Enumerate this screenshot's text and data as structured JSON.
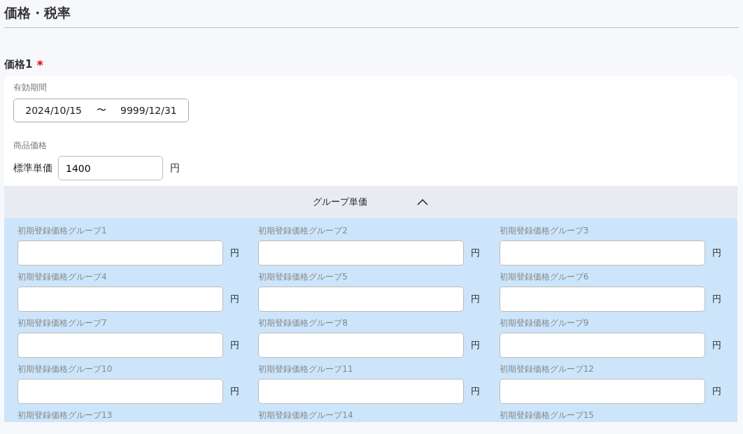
{
  "section_title": "価格・税率",
  "price": {
    "label": "価格1",
    "required_mark": "*",
    "period": {
      "label": "有効期間",
      "start": "2024/10/15",
      "separator": "〜",
      "end": "9999/12/31"
    },
    "product_price": {
      "label": "商品価格",
      "field_label": "標準単価",
      "value": "1400",
      "unit": "円"
    }
  },
  "group_panel": {
    "title": "グループ単価",
    "expanded": true,
    "groups": [
      {
        "label": "初期登録価格グループ1",
        "kind": "field",
        "unit": "円"
      },
      {
        "label": "初期登録価格グループ2",
        "kind": "field",
        "unit": "円"
      },
      {
        "label": "初期登録価格グループ3",
        "kind": "field",
        "unit": "円"
      },
      {
        "label": "初期登録価格グループ4",
        "kind": "field",
        "unit": "円"
      },
      {
        "label": "初期登録価格グループ5",
        "kind": "field",
        "unit": "円"
      },
      {
        "label": "初期登録価格グループ6",
        "kind": "field",
        "unit": "円"
      },
      {
        "label": "初期登録価格グループ7",
        "kind": "field",
        "unit": "円"
      },
      {
        "label": "初期登録価格グループ8",
        "kind": "field",
        "unit": "円"
      },
      {
        "label": "初期登録価格グループ9",
        "kind": "field",
        "unit": "円"
      },
      {
        "label": "初期登録価格グループ10",
        "kind": "field",
        "unit": "円"
      },
      {
        "label": "初期登録価格グループ11",
        "kind": "field",
        "unit": "円"
      },
      {
        "label": "初期登録価格グループ12",
        "kind": "field",
        "unit": "円"
      },
      {
        "label": "初期登録価格グループ13",
        "kind": "label-only"
      },
      {
        "label": "初期登録価格グループ14",
        "kind": "label-only"
      },
      {
        "label": "初期登録価格グループ15",
        "kind": "label-only"
      }
    ]
  }
}
